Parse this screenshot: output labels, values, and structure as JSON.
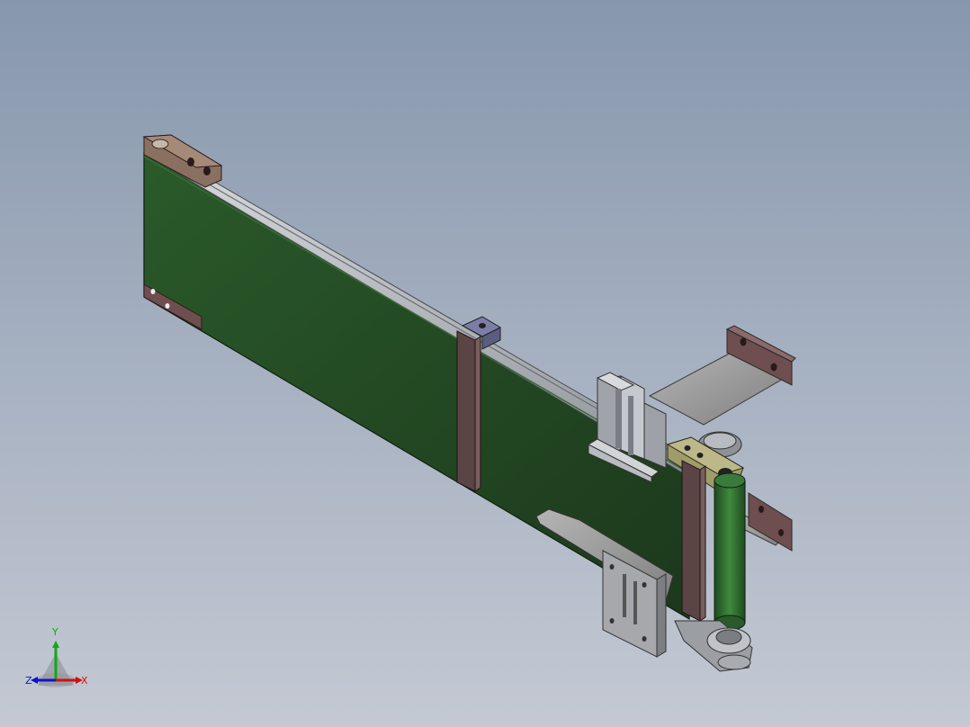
{
  "viewport": {
    "background_top": "#8797ad",
    "background_bottom": "#c4c9d3"
  },
  "model": {
    "belt_color": "#1f3f1f",
    "belt_edge_color": "#3d6e3d",
    "frame_color": "#5a4444",
    "rail_color": "#b8bcc2",
    "bracket_color": "#9a9a9a",
    "plate_color": "#6e5050",
    "roller_color": "#2f6a2f"
  },
  "triad": {
    "x_label": "X",
    "y_label": "Y",
    "z_label": "Z",
    "x_color": "#cc1111",
    "y_color": "#11aa11",
    "z_color": "#1111cc"
  }
}
